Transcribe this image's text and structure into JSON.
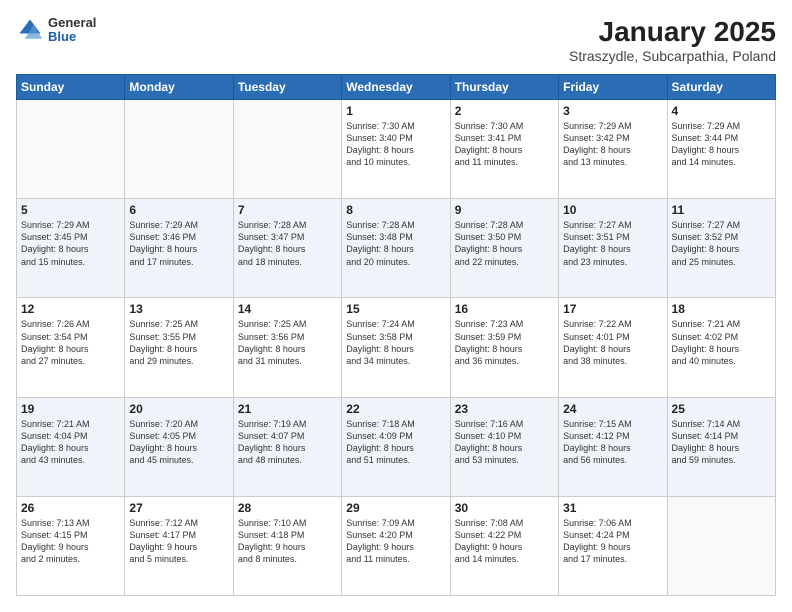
{
  "header": {
    "logo": {
      "general": "General",
      "blue": "Blue"
    },
    "title": "January 2025",
    "subtitle": "Straszydle, Subcarpathia, Poland"
  },
  "weekdays": [
    "Sunday",
    "Monday",
    "Tuesday",
    "Wednesday",
    "Thursday",
    "Friday",
    "Saturday"
  ],
  "weeks": [
    [
      {
        "day": "",
        "info": ""
      },
      {
        "day": "",
        "info": ""
      },
      {
        "day": "",
        "info": ""
      },
      {
        "day": "1",
        "info": "Sunrise: 7:30 AM\nSunset: 3:40 PM\nDaylight: 8 hours\nand 10 minutes."
      },
      {
        "day": "2",
        "info": "Sunrise: 7:30 AM\nSunset: 3:41 PM\nDaylight: 8 hours\nand 11 minutes."
      },
      {
        "day": "3",
        "info": "Sunrise: 7:29 AM\nSunset: 3:42 PM\nDaylight: 8 hours\nand 13 minutes."
      },
      {
        "day": "4",
        "info": "Sunrise: 7:29 AM\nSunset: 3:44 PM\nDaylight: 8 hours\nand 14 minutes."
      }
    ],
    [
      {
        "day": "5",
        "info": "Sunrise: 7:29 AM\nSunset: 3:45 PM\nDaylight: 8 hours\nand 15 minutes."
      },
      {
        "day": "6",
        "info": "Sunrise: 7:29 AM\nSunset: 3:46 PM\nDaylight: 8 hours\nand 17 minutes."
      },
      {
        "day": "7",
        "info": "Sunrise: 7:28 AM\nSunset: 3:47 PM\nDaylight: 8 hours\nand 18 minutes."
      },
      {
        "day": "8",
        "info": "Sunrise: 7:28 AM\nSunset: 3:48 PM\nDaylight: 8 hours\nand 20 minutes."
      },
      {
        "day": "9",
        "info": "Sunrise: 7:28 AM\nSunset: 3:50 PM\nDaylight: 8 hours\nand 22 minutes."
      },
      {
        "day": "10",
        "info": "Sunrise: 7:27 AM\nSunset: 3:51 PM\nDaylight: 8 hours\nand 23 minutes."
      },
      {
        "day": "11",
        "info": "Sunrise: 7:27 AM\nSunset: 3:52 PM\nDaylight: 8 hours\nand 25 minutes."
      }
    ],
    [
      {
        "day": "12",
        "info": "Sunrise: 7:26 AM\nSunset: 3:54 PM\nDaylight: 8 hours\nand 27 minutes."
      },
      {
        "day": "13",
        "info": "Sunrise: 7:25 AM\nSunset: 3:55 PM\nDaylight: 8 hours\nand 29 minutes."
      },
      {
        "day": "14",
        "info": "Sunrise: 7:25 AM\nSunset: 3:56 PM\nDaylight: 8 hours\nand 31 minutes."
      },
      {
        "day": "15",
        "info": "Sunrise: 7:24 AM\nSunset: 3:58 PM\nDaylight: 8 hours\nand 34 minutes."
      },
      {
        "day": "16",
        "info": "Sunrise: 7:23 AM\nSunset: 3:59 PM\nDaylight: 8 hours\nand 36 minutes."
      },
      {
        "day": "17",
        "info": "Sunrise: 7:22 AM\nSunset: 4:01 PM\nDaylight: 8 hours\nand 38 minutes."
      },
      {
        "day": "18",
        "info": "Sunrise: 7:21 AM\nSunset: 4:02 PM\nDaylight: 8 hours\nand 40 minutes."
      }
    ],
    [
      {
        "day": "19",
        "info": "Sunrise: 7:21 AM\nSunset: 4:04 PM\nDaylight: 8 hours\nand 43 minutes."
      },
      {
        "day": "20",
        "info": "Sunrise: 7:20 AM\nSunset: 4:05 PM\nDaylight: 8 hours\nand 45 minutes."
      },
      {
        "day": "21",
        "info": "Sunrise: 7:19 AM\nSunset: 4:07 PM\nDaylight: 8 hours\nand 48 minutes."
      },
      {
        "day": "22",
        "info": "Sunrise: 7:18 AM\nSunset: 4:09 PM\nDaylight: 8 hours\nand 51 minutes."
      },
      {
        "day": "23",
        "info": "Sunrise: 7:16 AM\nSunset: 4:10 PM\nDaylight: 8 hours\nand 53 minutes."
      },
      {
        "day": "24",
        "info": "Sunrise: 7:15 AM\nSunset: 4:12 PM\nDaylight: 8 hours\nand 56 minutes."
      },
      {
        "day": "25",
        "info": "Sunrise: 7:14 AM\nSunset: 4:14 PM\nDaylight: 8 hours\nand 59 minutes."
      }
    ],
    [
      {
        "day": "26",
        "info": "Sunrise: 7:13 AM\nSunset: 4:15 PM\nDaylight: 9 hours\nand 2 minutes."
      },
      {
        "day": "27",
        "info": "Sunrise: 7:12 AM\nSunset: 4:17 PM\nDaylight: 9 hours\nand 5 minutes."
      },
      {
        "day": "28",
        "info": "Sunrise: 7:10 AM\nSunset: 4:18 PM\nDaylight: 9 hours\nand 8 minutes."
      },
      {
        "day": "29",
        "info": "Sunrise: 7:09 AM\nSunset: 4:20 PM\nDaylight: 9 hours\nand 11 minutes."
      },
      {
        "day": "30",
        "info": "Sunrise: 7:08 AM\nSunset: 4:22 PM\nDaylight: 9 hours\nand 14 minutes."
      },
      {
        "day": "31",
        "info": "Sunrise: 7:06 AM\nSunset: 4:24 PM\nDaylight: 9 hours\nand 17 minutes."
      },
      {
        "day": "",
        "info": ""
      }
    ]
  ]
}
